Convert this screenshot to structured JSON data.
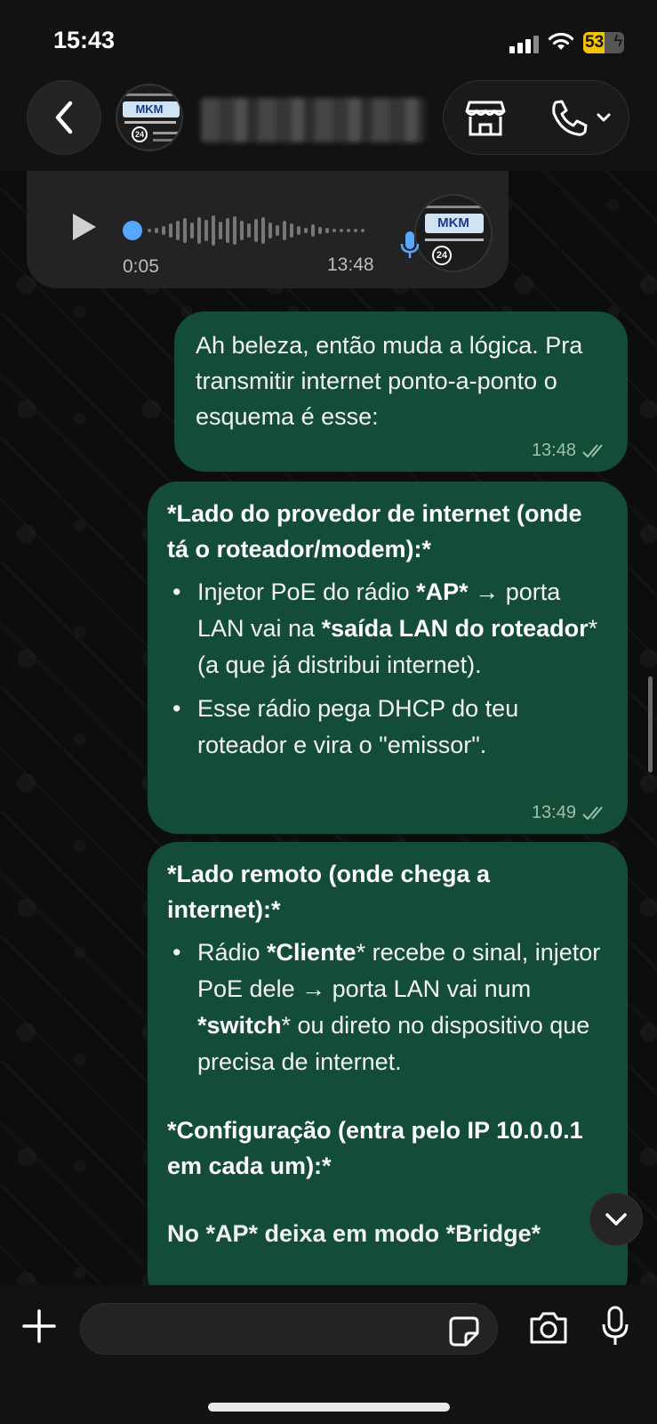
{
  "status_bar": {
    "time": "15:43",
    "battery_percent": "53",
    "battery_level": 0.53
  },
  "header": {
    "contact_name": "",
    "avatar_logo": "MKM",
    "avatar_badge": "24",
    "icons": [
      "back-icon",
      "store-icon",
      "phone-icon",
      "chevron-down-icon"
    ]
  },
  "messages": [
    {
      "type": "voice",
      "direction": "incoming",
      "duration": "0:05",
      "time": "13:48",
      "progress": 0
    },
    {
      "type": "text",
      "direction": "outgoing",
      "text": "Ah beleza, então muda a lógica. Pra transmitir internet ponto-a-ponto o esquema é esse:",
      "time": "13:48",
      "status": "read"
    },
    {
      "type": "text",
      "direction": "outgoing",
      "heading": "*Lado do provedor de internet (onde tá o roteador/modem):*",
      "bullets": [
        {
          "p1": "Injetor PoE do rádio ",
          "b1": "*AP*",
          "p2": " → porta LAN vai na ",
          "b2": "*saída LAN do roteador",
          "p3": "* (a que já distribui internet)."
        },
        {
          "p1": "Esse rádio pega DHCP do teu roteador e vira o \"emissor\"."
        }
      ],
      "time": "13:49",
      "status": "read"
    },
    {
      "type": "text",
      "direction": "outgoing",
      "heading": "*Lado remoto (onde chega a internet):*",
      "bullets": [
        {
          "p1": "Rádio ",
          "b1": "*Cliente",
          "p2": "* recebe o sinal, injetor PoE dele → porta LAN vai num ",
          "b2": "*switch",
          "p3": "* ou direto no dispositivo que precisa de internet."
        }
      ],
      "heading2": "*Configuração (entra pelo IP 10.0.0.1 em cada um):*",
      "partial": "No *AP* deixa em modo *Bridge*"
    }
  ],
  "composer": {
    "placeholder": "",
    "value": ""
  },
  "colors": {
    "outgoing_bubble": "#144d37",
    "incoming_bubble": "#232323",
    "accent_blue": "#58a6ff",
    "battery_yellow": "#f2c400"
  }
}
